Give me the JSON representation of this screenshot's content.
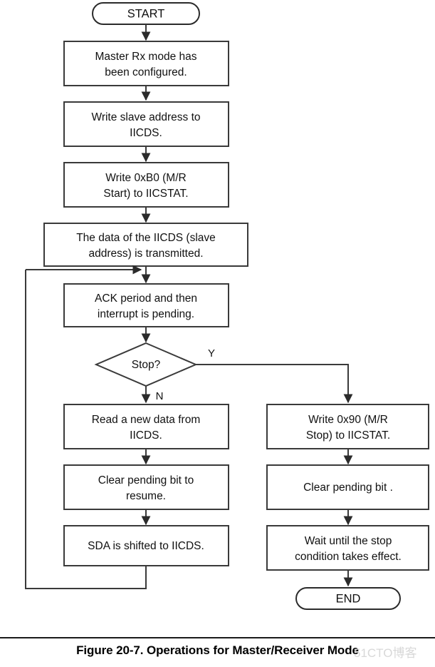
{
  "figure": {
    "caption": "Figure 20-7. Operations for Master/Receiver Mode",
    "watermark": "51CTO博客"
  },
  "colors": {
    "stroke": "#3a3a3a",
    "text": "#111111",
    "background": "#ffffff",
    "caption_rule": "#1a1a1a",
    "watermark": "#d8d8d8"
  },
  "flow": {
    "start": {
      "label": "START"
    },
    "end": {
      "label": "END"
    },
    "decision": {
      "label": "Stop?",
      "yes_label": "Y",
      "no_label": "N"
    },
    "steps": [
      {
        "id": "configured",
        "line1": "Master Rx mode has",
        "line2": "been configured."
      },
      {
        "id": "write-slave",
        "line1": "Write slave address to",
        "line2": "IICDS."
      },
      {
        "id": "write-b0",
        "line1": "Write 0xB0 (M/R",
        "line2": "Start) to IICSTAT."
      },
      {
        "id": "transmitted",
        "line1": "The data of the IICDS (slave",
        "line2": "address) is transmitted."
      },
      {
        "id": "ack-period",
        "line1": "ACK period and then",
        "line2": "interrupt is pending."
      }
    ],
    "no_branch": [
      {
        "id": "read-data",
        "line1": "Read a new data from",
        "line2": "IICDS."
      },
      {
        "id": "clear-resume",
        "line1": "Clear pending bit to",
        "line2": "resume."
      },
      {
        "id": "sda-shift",
        "line1": "SDA is shifted to IICDS.",
        "line2": ""
      }
    ],
    "yes_branch": [
      {
        "id": "write-90",
        "line1": "Write 0x90 (M/R",
        "line2": "Stop) to IICSTAT."
      },
      {
        "id": "clear-bit",
        "line1": "Clear pending bit .",
        "line2": ""
      },
      {
        "id": "wait-stop",
        "line1": "Wait until the stop",
        "line2": "condition takes effect."
      }
    ]
  }
}
